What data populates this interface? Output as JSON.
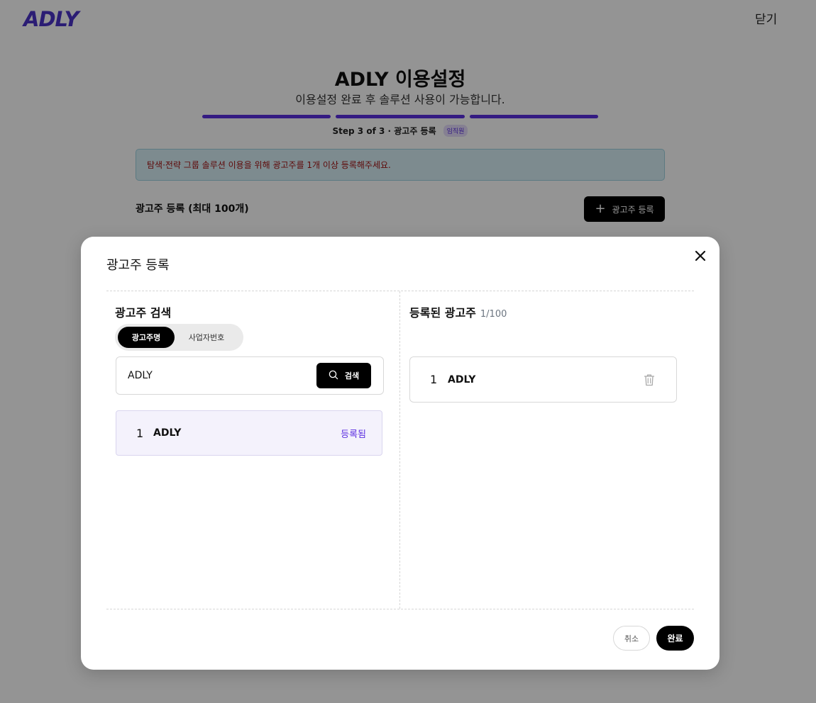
{
  "header": {
    "logo_text": "ADLY",
    "close_label": "닫기"
  },
  "setup": {
    "title": "ADLY 이용설정",
    "subtitle": "이용설정 완료 후 솔루션 사용이 가능합니다.",
    "step_label": "Step 3 of 3 · 광고주 등록",
    "role_badge": "임직원",
    "progress_steps": [
      1,
      1,
      1
    ],
    "notice": "탐색·전략 그룹 솔루션 이용을 위해 광고주를 1개 이상 등록해주세요.",
    "section_title": "광고주 등록 (최대 100개)",
    "add_button_label": "광고주 등록",
    "accent_color": "#5b2fe0"
  },
  "modal": {
    "title": "광고주 등록",
    "search": {
      "title": "광고주 검색",
      "toggle_options": [
        "광고주명",
        "사업자번호"
      ],
      "selected_option": "광고주명",
      "query": "ADLY",
      "button_label": "검색",
      "results": [
        {
          "num": "1",
          "name": "ADLY",
          "status": "등록됨"
        }
      ]
    },
    "registered": {
      "title": "등록된 광고주",
      "count": "1/100",
      "items": [
        {
          "num": "1",
          "name": "ADLY"
        }
      ]
    },
    "cancel_label": "취소",
    "done_label": "완료"
  }
}
